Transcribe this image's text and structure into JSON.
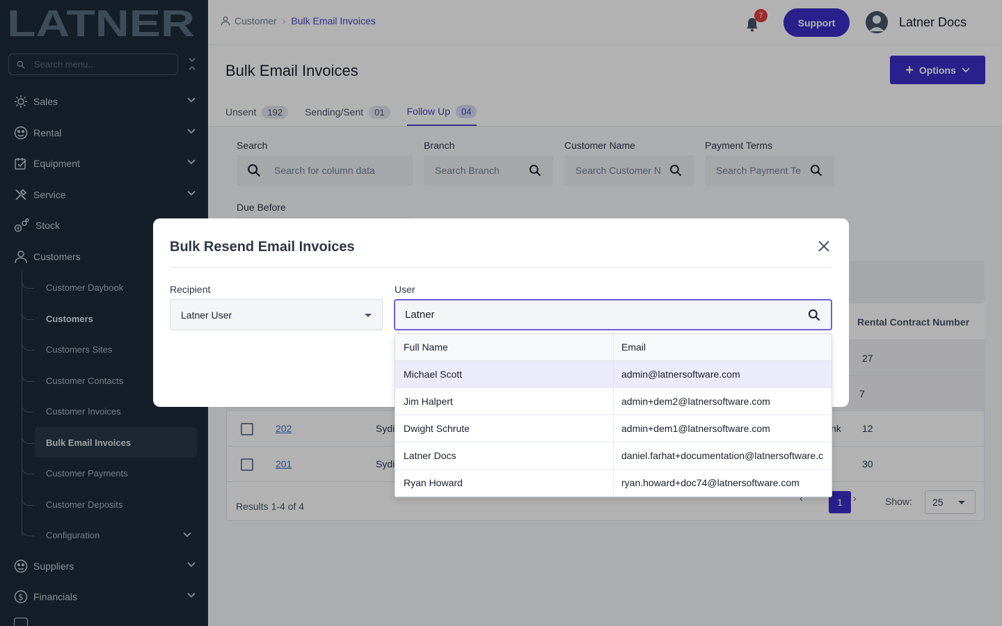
{
  "brand": {
    "logo_text": "LATNER"
  },
  "sidebar": {
    "search_placeholder": "Search menu...",
    "items": [
      {
        "label": "Sales",
        "icon": "sales-icon"
      },
      {
        "label": "Rental",
        "icon": "rental-icon"
      },
      {
        "label": "Equipment",
        "icon": "equipment-icon"
      },
      {
        "label": "Service",
        "icon": "service-icon"
      },
      {
        "label": "Stock",
        "icon": "stock-icon"
      },
      {
        "label": "Customers",
        "icon": "customers-icon"
      },
      {
        "label": "Suppliers",
        "icon": "suppliers-icon"
      },
      {
        "label": "Financials",
        "icon": "financials-icon"
      }
    ],
    "sub_items": [
      {
        "label": "Customer Daybook"
      },
      {
        "label": "Customers"
      },
      {
        "label": "Customers Sites"
      },
      {
        "label": "Customer Contacts"
      },
      {
        "label": "Customer Invoices"
      },
      {
        "label": "Bulk Email Invoices"
      },
      {
        "label": "Customer Payments"
      },
      {
        "label": "Customer Deposits"
      },
      {
        "label": "Configuration"
      }
    ]
  },
  "header": {
    "breadcrumb": [
      "Customer",
      "Bulk Email Invoices"
    ],
    "notification_count": "7",
    "support_label": "Support",
    "user_name": "Latner Docs"
  },
  "page": {
    "title": "Bulk Email Invoices",
    "options_label": "Options",
    "tabs": [
      {
        "label": "Unsent",
        "count": "192"
      },
      {
        "label": "Sending/Sent",
        "count": "01"
      },
      {
        "label": "Follow Up",
        "count": "04",
        "active": true
      }
    ],
    "filters": {
      "search_label": "Search",
      "search_placeholder": "Search for column data",
      "branch_label": "Branch",
      "branch_placeholder": "Search Branch",
      "customer_label": "Customer Name",
      "customer_placeholder": "Search Customer N",
      "payment_label": "Payment Terms",
      "payment_placeholder": "Search Payment Te",
      "due_label": "Due Before"
    },
    "table": {
      "last_column_header": "Rental Contract Number",
      "rows": [
        {
          "num": "",
          "branch": "",
          "extra": "",
          "rental": "27"
        },
        {
          "num": "",
          "branch": "",
          "extra": "",
          "rental": "7"
        },
        {
          "num": "202",
          "branch": "Sydi",
          "extra": "nk",
          "rental": "12"
        },
        {
          "num": "201",
          "branch": "Sydi",
          "extra": "",
          "rental": "30"
        }
      ],
      "results_text": "Results 1-4 of 4",
      "current_page": "1",
      "show_label": "Show:",
      "page_size": "25"
    }
  },
  "modal": {
    "title": "Bulk Resend Email Invoices",
    "recipient_label": "Recipient",
    "recipient_value": "Latner User",
    "user_label": "User",
    "user_value": "Latner",
    "dropdown": {
      "headers": [
        "Full Name",
        "Email"
      ],
      "rows": [
        {
          "name": "Michael Scott",
          "email": "admin@latnersoftware.com"
        },
        {
          "name": "Jim Halpert",
          "email": "admin+dem2@latnersoftware.com"
        },
        {
          "name": "Dwight Schrute",
          "email": "admin+dem1@latnersoftware.com"
        },
        {
          "name": "Latner Docs",
          "email": "daniel.farhat+documentation@latnersoftware.c"
        },
        {
          "name": "Ryan Howard",
          "email": "ryan.howard+doc74@latnersoftware.com"
        }
      ]
    }
  },
  "colors": {
    "sidebar_bg": "#1c2b3a",
    "accent": "#3b2fc9",
    "logo": "#5a6e82",
    "badge": "#e53e3e"
  }
}
